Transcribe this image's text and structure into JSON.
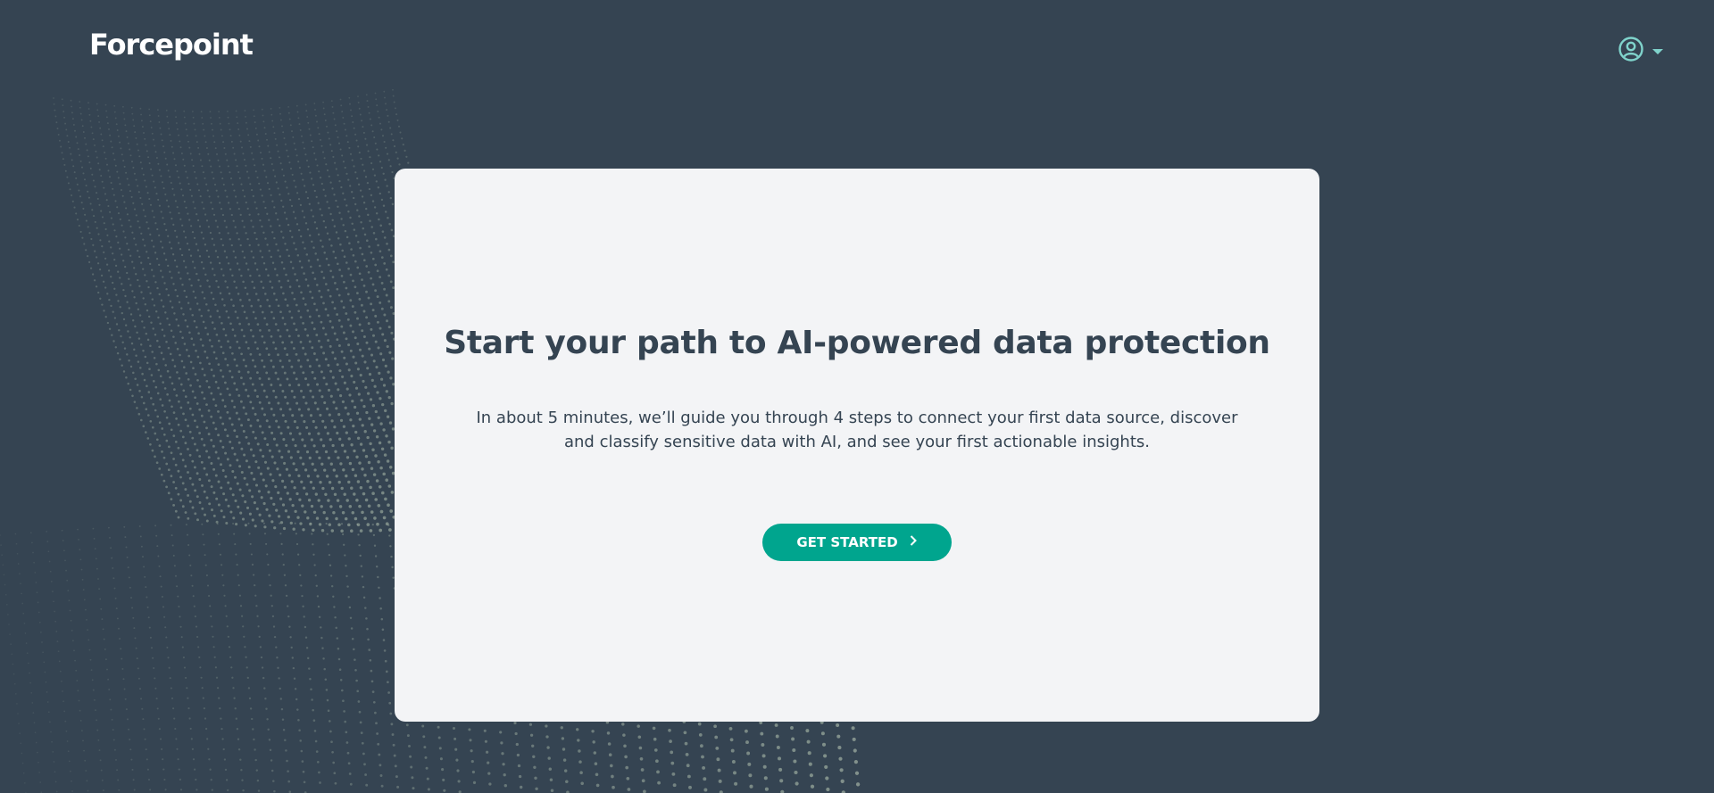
{
  "header": {
    "logo_text": "Forcepoint",
    "user_icon": "user-circle-icon",
    "menu_icon": "caret-down-icon"
  },
  "card": {
    "title": "Start your path to AI-powered data protection",
    "description": "In about 5 minutes, we’ll guide you through 4 steps to connect your first data source, discover and classify sensitive data with AI, and see your first actionable insights.",
    "cta_label": "GET STARTED",
    "cta_icon": "chevron-right-icon"
  },
  "colors": {
    "background": "#354452",
    "card": "#f3f4f6",
    "accent": "#00a58e",
    "icon": "#7fd3cb",
    "dots": "#a8b8a8"
  }
}
